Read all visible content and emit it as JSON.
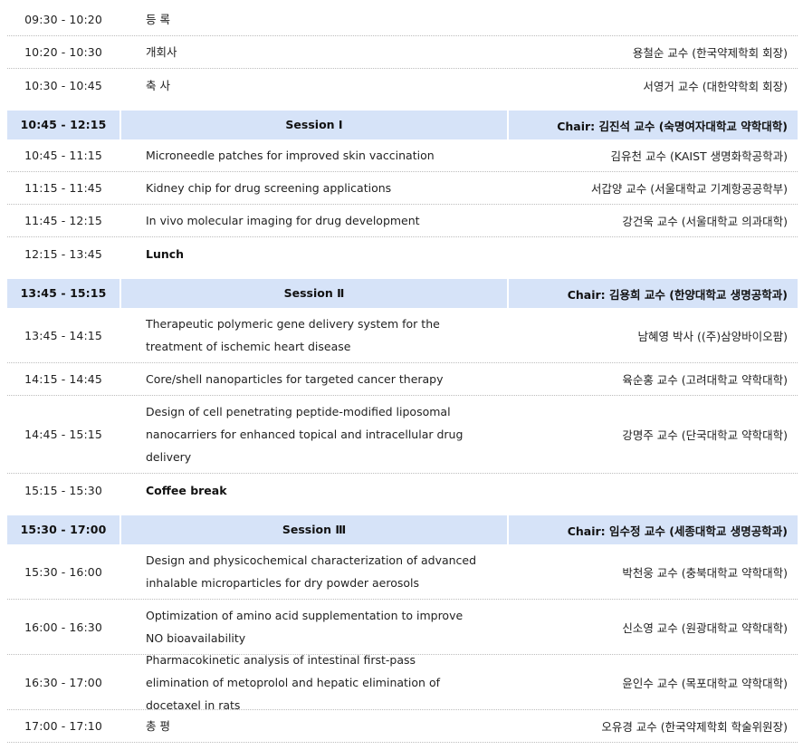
{
  "rows": [
    {
      "time": "09:30 - 10:20",
      "title": "등 록",
      "speaker": ""
    },
    {
      "time": "10:20 - 10:30",
      "title": "개회사",
      "speaker": "용철순 교수 (한국약제학회 회장)"
    },
    {
      "time": "10:30 - 10:45",
      "title": "축 사",
      "speaker": "서영거 교수 (대한약학회 회장)"
    },
    {
      "time": "10:45 - 12:15",
      "session": "Session Ⅰ",
      "chair": "Chair: 김진석 교수 (숙명여자대학교 약학대학)"
    },
    {
      "time": "10:45 - 11:15",
      "title": "Microneedle patches for improved skin vaccination",
      "speaker": "김유천 교수 (KAIST 생명화학공학과)"
    },
    {
      "time": "11:15 - 11:45",
      "title": "Kidney chip for drug screening applications",
      "speaker": "서갑양 교수 (서울대학교 기계항공공학부)"
    },
    {
      "time": "11:45 - 12:15",
      "title": "In vivo molecular imaging for drug development",
      "speaker": "강건욱 교수 (서울대학교 의과대학)"
    },
    {
      "time": "12:15 - 13:45",
      "title": "Lunch",
      "speaker": ""
    },
    {
      "time": "13:45 - 15:15",
      "session": "Session Ⅱ",
      "chair": "Chair: 김용희 교수 (한양대학교 생명공학과)"
    },
    {
      "time": "13:45 - 14:15",
      "title": "Therapeutic polymeric gene delivery system for the treatment of ischemic heart disease",
      "speaker": "남혜영 박사 ((주)삼양바이오팜)"
    },
    {
      "time": "14:15 - 14:45",
      "title": "Core/shell nanoparticles for targeted cancer therapy",
      "speaker": "육순홍 교수 (고려대학교 약학대학)"
    },
    {
      "time": "14:45 - 15:15",
      "title": "Design of cell penetrating peptide-modified liposomal nanocarriers for enhanced topical and intracellular drug delivery",
      "speaker": "강명주 교수 (단국대학교 약학대학)"
    },
    {
      "time": "15:15 - 15:30",
      "title": "Coffee break",
      "speaker": ""
    },
    {
      "time": "15:30 - 17:00",
      "session": "Session Ⅲ",
      "chair": "Chair: 임수정 교수 (세종대학교 생명공학과)"
    },
    {
      "time": "15:30 - 16:00",
      "title": "Design and physicochemical characterization of advanced inhalable microparticles for dry powder aerosols",
      "speaker": "박천웅 교수 (충북대학교 약학대학)"
    },
    {
      "time": "16:00 - 16:30",
      "title": "Optimization of amino acid supplementation to improve NO bioavailability",
      "speaker": "신소영 교수 (원광대학교 약학대학)"
    },
    {
      "time": "16:30 - 17:00",
      "title": "Pharmacokinetic analysis of intestinal first-pass elimination of metoprolol and hepatic elimination of docetaxel in rats",
      "speaker": "윤인수 교수 (목포대학교 약학대학)"
    },
    {
      "time": "17:00 - 17:10",
      "title": "총 평",
      "speaker": "오유경 교수 (한국약제학회 학술위원장)"
    }
  ],
  "colors": {
    "session_band": "#d6e3f8",
    "divider": "#bdbdbd"
  }
}
